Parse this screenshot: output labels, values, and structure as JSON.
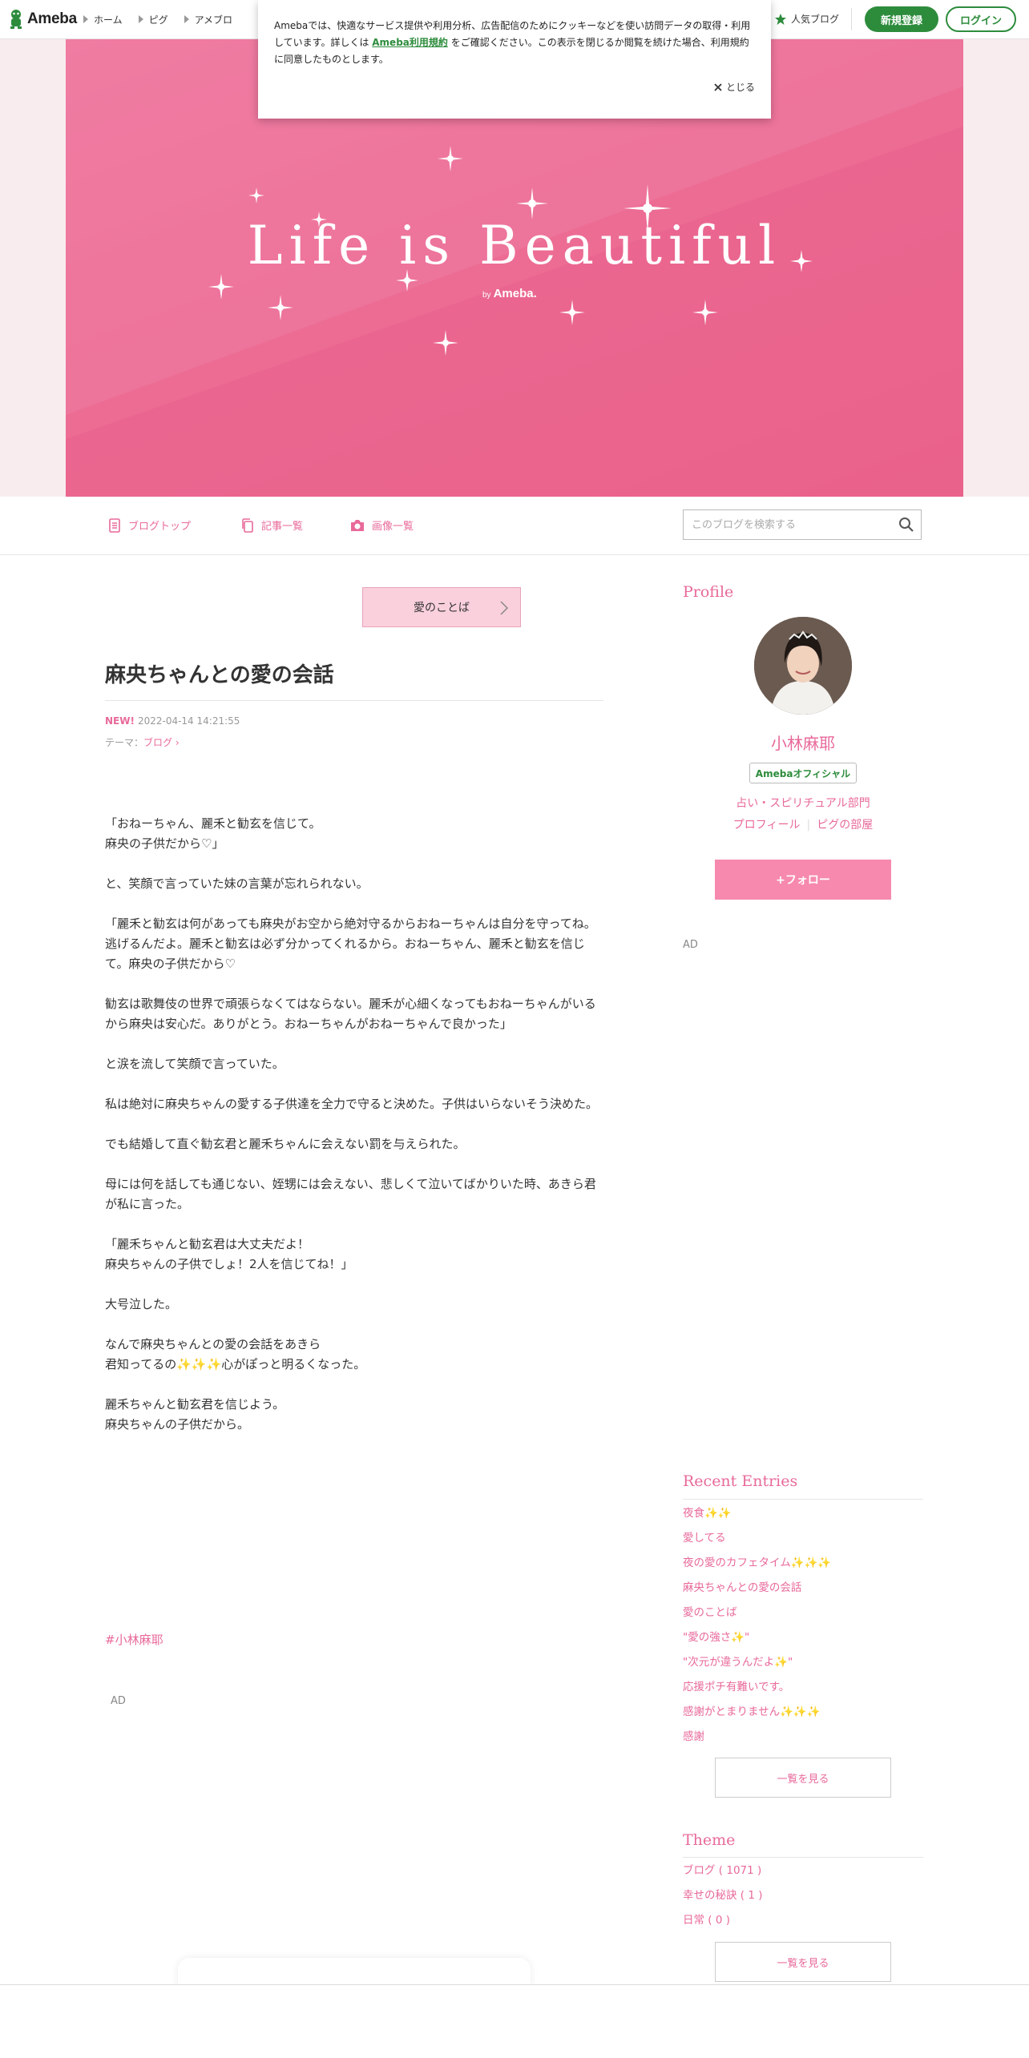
{
  "global_nav": {
    "logo_text": "Ameba",
    "items": [
      "ホーム",
      "ピグ",
      "アメブロ"
    ],
    "popular_label": "人気ブログ",
    "register_label": "新規登録",
    "login_label": "ログイン"
  },
  "cookie_notice": {
    "text_before": "Amebaでは、快適なサービス提供や利用分析、広告配信のためにクッキーなどを使い訪問データの取得・利用しています。詳しくは ",
    "link_text": "Ameba利用規約",
    "text_after": " をご確認ください。この表示を閉じるか閲覧を続けた場合、利用規約に同意したものとします。",
    "close_label": "とじる"
  },
  "header": {
    "title": "Life is Beautiful",
    "by_prefix": "by",
    "by_brand": "Ameba."
  },
  "blog_nav": {
    "top_label": "ブログトップ",
    "entries_label": "記事一覧",
    "images_label": "画像一覧",
    "search_placeholder": "このブログを検索する"
  },
  "entry": {
    "theme_button": "愛のことば",
    "title": "麻央ちゃんとの愛の会話",
    "new_badge": "NEW!",
    "datetime": "2022-04-14 14:21:55",
    "theme_prefix": "テーマ：",
    "theme_link": "ブログ",
    "paragraphs": [
      "「おねーちゃん、麗禾と勧玄を信じて。\n麻央の子供だから♡」",
      "と、笑顔で言っていた妹の言葉が忘れられない。",
      "「麗禾と勧玄は何があっても麻央がお空から絶対守るからおねーちゃんは自分を守ってね。逃げるんだよ。麗禾と勧玄は必ず分かってくれるから。おねーちゃん、麗禾と勧玄を信じて。麻央の子供だから♡",
      "勧玄は歌舞伎の世界で頑張らなくてはならない。麗禾が心細くなってもおねーちゃんがいるから麻央は安心だ。ありがとう。おねーちゃんがおねーちゃんで良かった」",
      "と涙を流して笑顔で言っていた。",
      "私は絶対に麻央ちゃんの愛する子供達を全力で守ると決めた。子供はいらないそう決めた。",
      "でも結婚して直ぐ勧玄君と麗禾ちゃんに会えない罰を与えられた。",
      "母には何を話しても通じない、姪甥には会えない、悲しくて泣いてばかりいた時、あきら君が私に言った。",
      "「麗禾ちゃんと勧玄君は大丈夫だよ！\n麻央ちゃんの子供でしょ！2人を信じてね！」",
      "大号泣した。",
      "なんで麻央ちゃんとの愛の会話をあきら\n君知ってるの✨✨✨心がぽっと明るくなった。",
      "麗禾ちゃんと勧玄君を信じよう。\n麻央ちゃんの子供だから。"
    ],
    "hashtag": "#小林麻耶",
    "ad_label": "AD"
  },
  "sidebar": {
    "profile_heading": "Profile",
    "name": "小林麻耶",
    "official_badge": "Amebaオフィシャル",
    "genre": "占い・スピリチュアル部門",
    "profile_link": "プロフィール",
    "pig_room_link": "ピグの部屋",
    "follow_label": "+フォロー",
    "ad_label": "AD",
    "recent_heading": "Recent Entries",
    "recent_entries": [
      "夜食✨✨",
      "愛してる",
      "夜の愛のカフェタイム✨✨✨",
      "麻央ちゃんとの愛の会話",
      "愛のことば",
      "\"愛の強さ✨\"",
      "\"次元が違うんだよ✨\"",
      "応援ポチ有難いです。",
      "感謝がとまりません✨✨✨",
      "感謝"
    ],
    "recent_more": "一覧を見る",
    "theme_heading": "Theme",
    "themes": [
      "ブログ ( 1071 )",
      "幸せの秘訣 ( 1 )",
      "日常 ( 0 )"
    ],
    "theme_more": "一覧を見る"
  },
  "colors": {
    "accent_pink": "#e8699a",
    "ameba_green": "#2d8c3c",
    "header_pink": "#ec6d95"
  }
}
